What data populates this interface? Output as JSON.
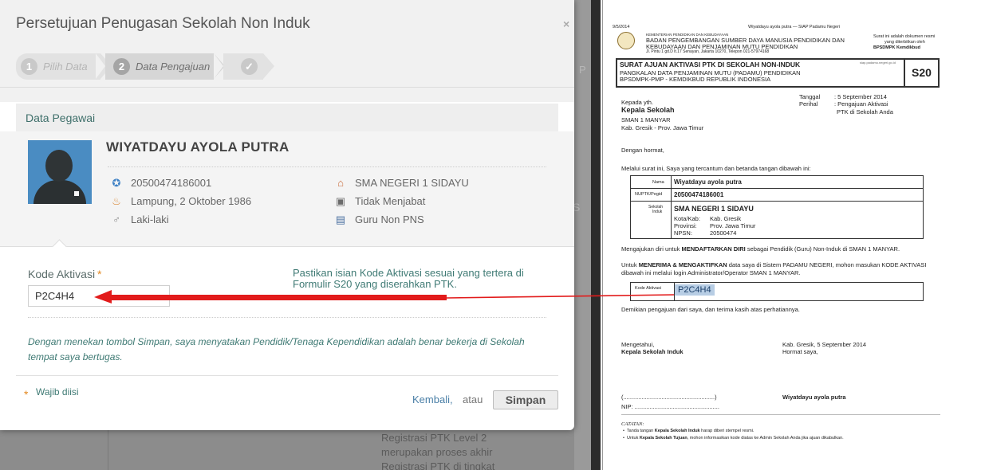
{
  "modal": {
    "title": "Persetujuan Penugasan Sekolah Non Induk",
    "close": "×",
    "wizard": [
      {
        "num": "1",
        "label": "Pilih Data"
      },
      {
        "num": "2",
        "label": "Data Pengajuan"
      },
      {
        "icon": "check-icon"
      }
    ],
    "section_title": "Data Pegawai",
    "employee": {
      "name": "WIYATDAYU AYOLA PUTRA",
      "nuptk": "20500474186001",
      "birth": "Lampung, 2 Oktober 1986",
      "gender": "Laki-laki",
      "school": "SMA NEGERI 1 SIDAYU",
      "position": "Tidak Menjabat",
      "status": "Guru Non PNS"
    },
    "form": {
      "kode_label": "Kode Aktivasi",
      "required_mark": "*",
      "kode_value": "P2C4H4",
      "hint": "Pastikan isian Kode Aktivasi sesuai yang tertera di Formulir S20 yang diserahkan PTK.",
      "disclaimer": "Dengan menekan tombol Simpan, saya menyatakan Pendidik/Tenaga Kependidikan adalah benar bekerja di Sekolah tempat saya bertugas.",
      "required_note": "Wajib diisi",
      "back": "Kembali,",
      "or": "atau",
      "save": "Simpan"
    }
  },
  "background": {
    "behind_text": "Registrasi PTK Level 2 merupakan proses akhir Registrasi PTK di tingkat",
    "stub_p": "P",
    "stub_s": "S",
    "close": "×"
  },
  "document": {
    "date": "9/5/2014",
    "header_title": "Wiyatdayu ayola putra — SIAP Padamu Negeri",
    "ministry": "KEMENTERIAN PENDIDIKAN DAN KEBUDAYAAN",
    "agency1": "BADAN PENGEMBANGAN SUMBER DAYA MANUSIA PENDIDIKAN DAN",
    "agency2": "KEBUDAYAAN DAN PENJAMINAN MUTU PENDIDIKAN",
    "address": "Jl. Pintu 1 gd.D lt.17 Senayan, Jakarta 10270, Telepon 021-57974168",
    "right_note1": "Surat ini adalah dokumen resmi",
    "right_note2": "yang diterbitkan oleh",
    "right_note3": "BPSDMPK Kemdikbud",
    "form_title": "SURAT AJUAN AKTIVASI PTK DI SEKOLAH NON-INDUK",
    "form_sub1": "PANGKALAN DATA PENJAMINAN MUTU (PADAMU) PENDIDIKAN",
    "form_sub2": "BPSDMPK-PMP - KEMDIKBUD REPUBLIK INDONESIA",
    "form_code": "S20",
    "form_url": "siap.padamu.negeri.go.id",
    "tanggal_label": "Tanggal",
    "tanggal_value": ": 5 September 2014",
    "perihal_label": "Perihal",
    "perihal_value1": ": Pengajuan Aktivasi",
    "perihal_value2": "PTK di Sekolah Anda",
    "kepada": "Kepada yth.",
    "kepala": "Kepala Sekolah",
    "school": "SMAN 1 MANYAR",
    "region": "Kab. Gresik - Prov. Jawa Timur",
    "greeting": "Dengan hormat,",
    "intro": "Melalui surat ini, Saya yang tercantum dan betanda tangan dibawah ini:",
    "t_nama_label": "Nama",
    "t_nama": "Wiyatdayu ayola putra",
    "t_nuptk_label": "NUPTK/Pegid",
    "t_nuptk": "20500474186001",
    "t_sekolah_label1": "Sekolah",
    "t_sekolah_label2": "Induk",
    "t_sekolah": "SMA NEGERI 1 SIDAYU",
    "t_kota_label": "Kota/Kab:",
    "t_kota": "Kab. Gresik",
    "t_prov_label": "Provinsi:",
    "t_prov": "Prov. Jawa Timur",
    "t_npsn_label": "NPSN:",
    "t_npsn": "20500474",
    "p_mengajukan_a": "Mengajukan diri untuk ",
    "p_mengajukan_b": "MENDAFTARKAN DIRI",
    "p_mengajukan_c": " sebagai Pendidik (Guru) Non-Induk di SMAN 1 MANYAR.",
    "p_untuk_a": "Untuk ",
    "p_untuk_b": "MENERIMA & MENGAKTIFKAN",
    "p_untuk_c": " data saya di Sistem PADAMU NEGERI, mohon masukan KODE AKTIVASI",
    "p_untuk_2": "dibawah ini melalui login Administrator/Operator SMAN 1 MANYAR.",
    "kode_label": "Kode Aktivasi",
    "kode_value": "P2C4H4",
    "closing": "Demikian pengajuan dari saya, dan terima kasih atas perhatiannya.",
    "mengetahui": "Mengetahui,",
    "kepala_induk": "Kepala Sekolah Induk",
    "place_date": "Kab. Gresik, 5 September 2014",
    "hormat": "Hormat saya,",
    "sign_blank": "(.......................................................)",
    "nip": "NIP: ...................................................",
    "signer": "Wiyatdayu ayola putra",
    "catatan": "CATATAN:",
    "note1_a": "Tanda tangan ",
    "note1_b": "Kepala Sekolah Induk",
    "note1_c": " harap diberi stempel resmi.",
    "note2_a": "Untuk ",
    "note2_b": "Kepala Sekolah Tujuan",
    "note2_c": ", mohon informasikan kode diatas ke Admin Sekolah Anda jika ajuan dikabulkan."
  },
  "colors": {
    "accent_teal": "#3f7a74",
    "required_orange": "#e38a23",
    "arrow_red": "#e21b1b",
    "highlight_blue": "#b7cde4"
  }
}
